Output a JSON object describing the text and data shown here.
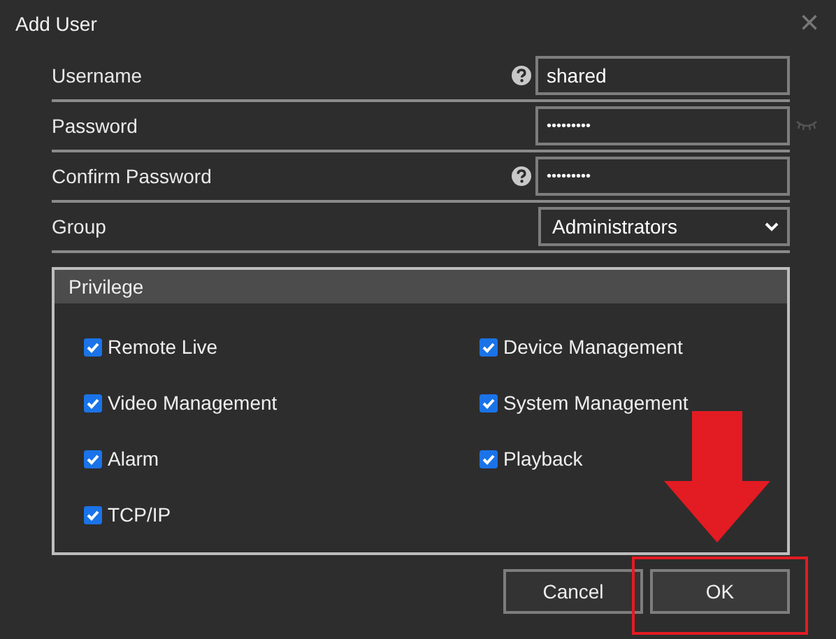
{
  "window": {
    "title": "Add User",
    "close": "×"
  },
  "fields": [
    {
      "label": "Username",
      "kind": "text",
      "value": "shared",
      "help": true,
      "reveal": false
    },
    {
      "label": "Password",
      "kind": "password",
      "value": "•••••••••",
      "help": false,
      "reveal": true
    },
    {
      "label": "Confirm Password",
      "kind": "password",
      "value": "•••••••••",
      "help": true,
      "reveal": false
    },
    {
      "label": "Group",
      "kind": "select",
      "value": "Administrators",
      "help": false,
      "reveal": false
    }
  ],
  "privilege": {
    "title": "Privilege",
    "items": [
      {
        "label": "Remote Live",
        "checked": true
      },
      {
        "label": "Device Management",
        "checked": true
      },
      {
        "label": "Video Management",
        "checked": true
      },
      {
        "label": "System Management",
        "checked": true
      },
      {
        "label": "Alarm",
        "checked": true
      },
      {
        "label": "Playback",
        "checked": true
      },
      {
        "label": "TCP/IP",
        "checked": true
      }
    ]
  },
  "buttons": [
    {
      "label": "Cancel",
      "highlighted": false
    },
    {
      "label": "OK",
      "highlighted": true
    }
  ]
}
